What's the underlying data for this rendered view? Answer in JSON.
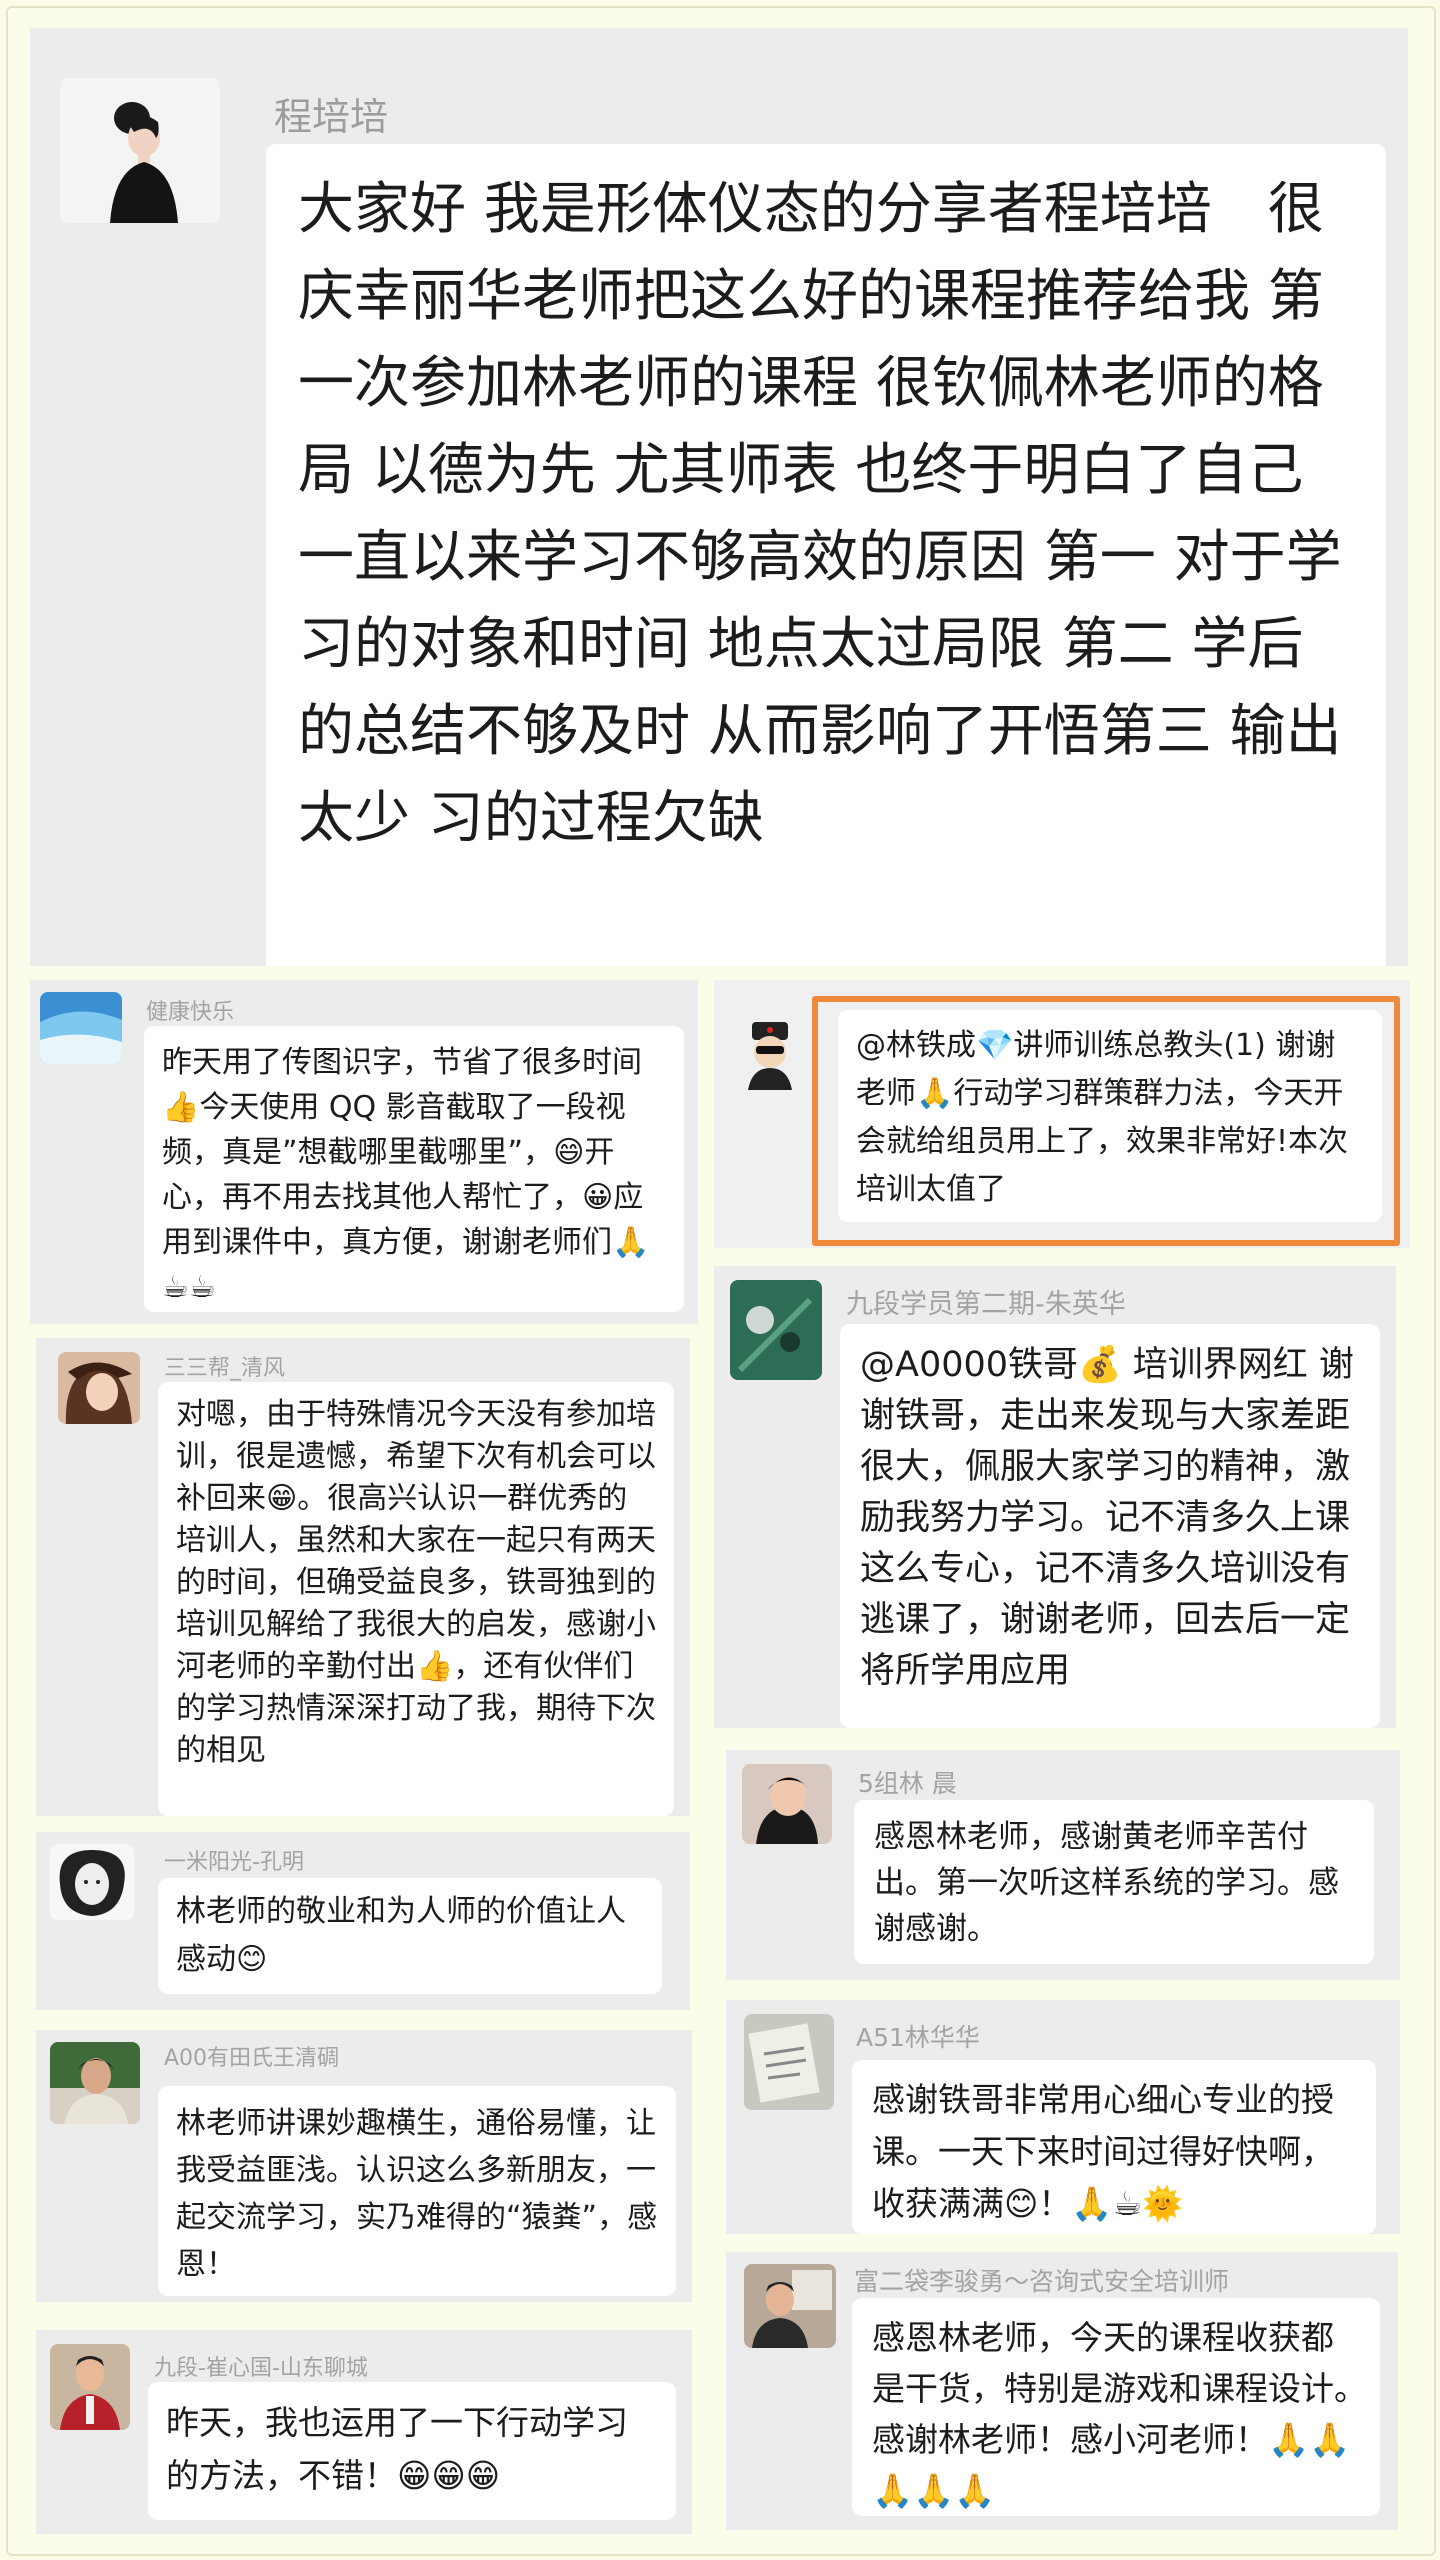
{
  "top_message": {
    "name": "程培培",
    "text": "大家好 我是形体仪态的分享者程培培　很庆幸丽华老师把这么好的课程推荐给我 第一次参加林老师的课程 很钦佩林老师的格局 以德为先 尤其师表 也终于明白了自己一直以来学习不够高效的原因 第一 对于学习的对象和时间 地点太过局限 第二 学后的总结不够及时 从而影响了开悟第三 输出太少 习的过程欠缺"
  },
  "left_messages": [
    {
      "name": "健康快乐",
      "text": "昨天用了传图识字，节省了很多时间👍今天使用 QQ 影音截取了一段视频，真是”想截哪里截哪里”，😄开心，再不用去找其他人帮忙了，😀应用到课件中，真方便，谢谢老师们🙏☕☕"
    },
    {
      "name": "三三帮_清风",
      "text": "对嗯，由于特殊情况今天没有参加培训，很是遗憾，希望下次有机会可以补回来😁。很高兴认识一群优秀的培训人，虽然和大家在一起只有两天的时间，但确受益良多，铁哥独到的培训见解给了我很大的启发，感谢小河老师的辛勤付出👍，还有伙伴们的学习热情深深打动了我，期待下次的相见"
    },
    {
      "name": "一米阳光-孔明",
      "text": "林老师的敬业和为人师的价值让人感动😊"
    },
    {
      "name": "A00有田氏王清碉",
      "text": "林老师讲课妙趣横生，通俗易懂，让我受益匪浅。认识这么多新朋友，一起交流学习，实乃难得的“猿粪”，感恩！"
    },
    {
      "name": "九段-崔心国-山东聊城",
      "text": "昨天，我也运用了一下行动学习的方法，不错！😁😁😁"
    }
  ],
  "right_messages": [
    {
      "name": "",
      "text": "@林铁成💎讲师训练总教头(1) 谢谢老师🙏行动学习群策群力法，今天开会就给组员用上了，效果非常好!本次培训太值了"
    },
    {
      "name": "九段学员第二期-朱英华",
      "text": "@A0000铁哥💰 培训界网红 谢谢铁哥，走出来发现与大家差距很大，佩服大家学习的精神，激励我努力学习。记不清多久上课这么专心，记不清多久培训没有逃课了，谢谢老师，回去后一定将所学用应用"
    },
    {
      "name": "5组林 晨",
      "text": "感恩林老师，感谢黄老师辛苦付出。第一次听这样系统的学习。感谢感谢。"
    },
    {
      "name": "A51林华华",
      "text": "感谢铁哥非常用心细心专业的授课。一天下来时间过得好快啊，收获满满😊！🙏☕🌞"
    },
    {
      "name": "富二袋李骏勇～咨询式安全培训师",
      "text": "感恩林老师，今天的课程收获都是干货，特别是游戏和课程设计。　感谢林老师！感小河老师！🙏🙏🙏🙏🙏"
    }
  ],
  "colors": {
    "panel": "#ececec",
    "bubble": "#ffffff",
    "highlight": "#ef8a3c",
    "name": "#a3a3a3"
  }
}
